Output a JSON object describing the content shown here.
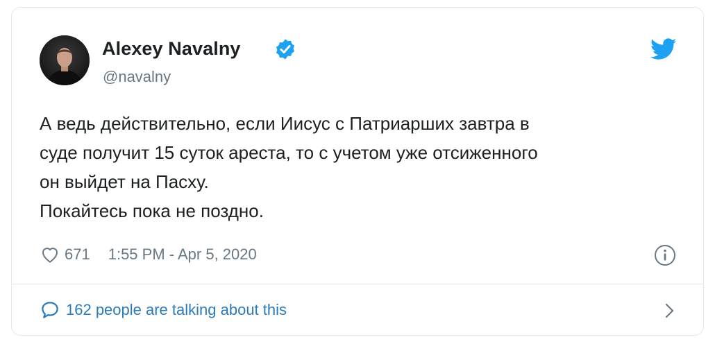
{
  "tweet": {
    "author": {
      "name": "Alexey Navalny",
      "handle": "@navalny"
    },
    "text_lines": [
      "А ведь действительно, если Иисус с Патриарших завтра в",
      "суде получит 15 суток ареста, то с учетом уже отсиженного",
      "он выйдет на Пасху.",
      "Покайтесь пока не поздно."
    ],
    "likes": "671",
    "timestamp": "1:55 PM - Apr 5, 2020",
    "talking": "162 people are talking about this"
  },
  "colors": {
    "accent": "#1da1f2",
    "link": "#2b7bb9",
    "muted": "#697882",
    "text": "#1c2022",
    "border": "#e1e8ed"
  },
  "icons": [
    "verified-badge-icon",
    "twitter-bird-icon",
    "heart-icon",
    "info-icon",
    "comment-bubble-icon",
    "chevron-right-icon"
  ]
}
